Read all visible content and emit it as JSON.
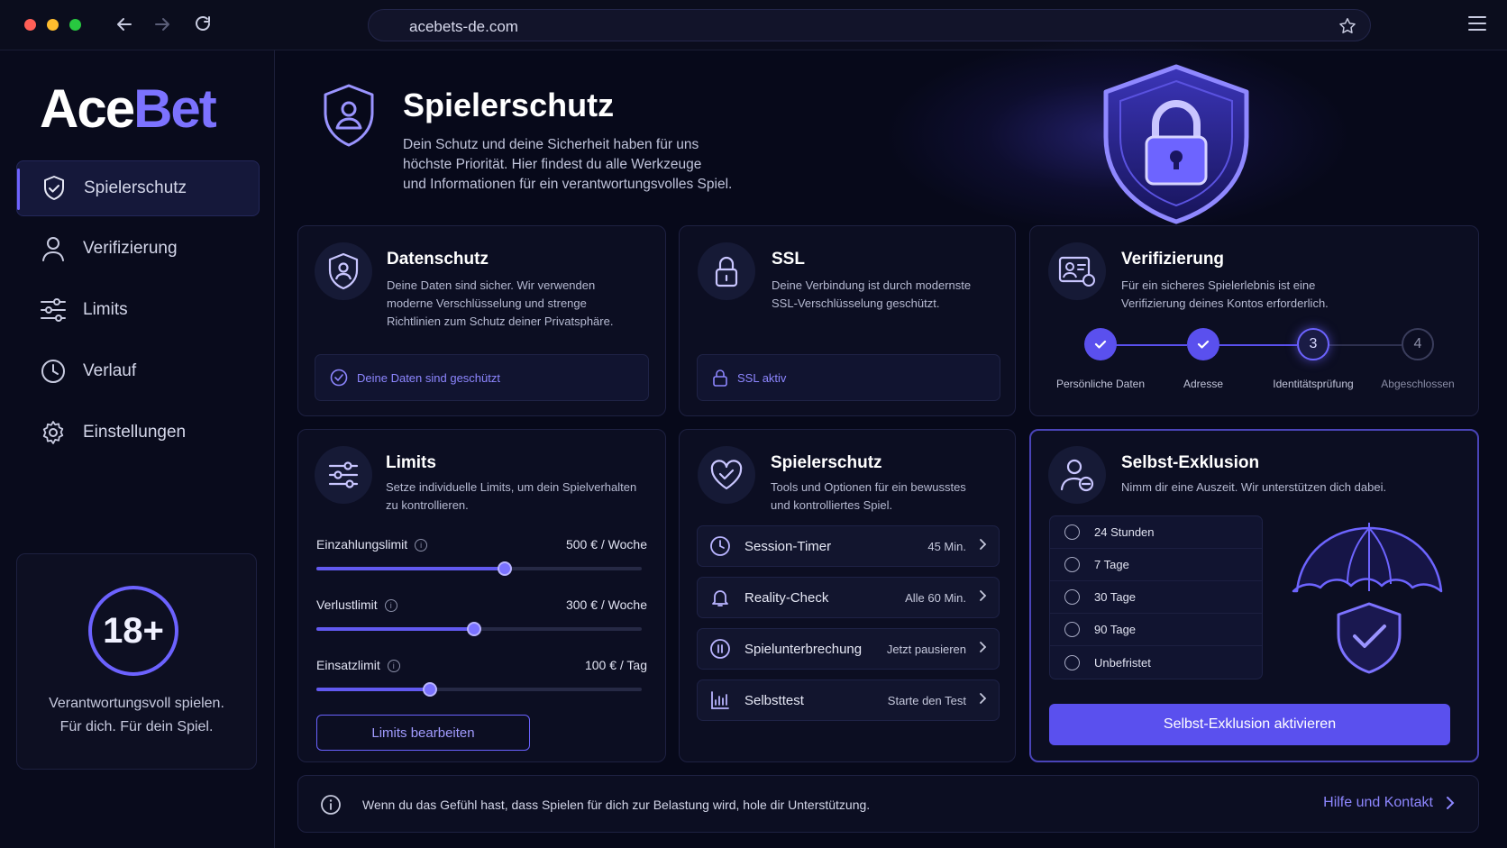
{
  "browser": {
    "url": "acebets-de.com",
    "icons": [
      "back-arrow-icon",
      "forward-arrow-icon",
      "reload-icon",
      "star-icon",
      "hamburger-menu-icon"
    ]
  },
  "brand": {
    "part1": "Ace",
    "part2": "Bet",
    "accent": "#7c72ff"
  },
  "sidebar": {
    "items": [
      {
        "label": "Spielerschutz",
        "icon": "shield-check-icon",
        "active": true
      },
      {
        "label": "Verifizierung",
        "icon": "user-icon"
      },
      {
        "label": "Limits",
        "icon": "sliders-icon"
      },
      {
        "label": "Verlauf",
        "icon": "clock-icon"
      },
      {
        "label": "Einstellungen",
        "icon": "gear-icon"
      }
    ],
    "age_badge": "18+",
    "age_text_line1": "Verantwortungsvoll spielen.",
    "age_text_line2": "Für dich. Für dein Spiel."
  },
  "header": {
    "title": "Spielerschutz",
    "subtitle_line1": "Dein Schutz und deine Sicherheit haben für uns",
    "subtitle_line2": "höchste Priorität. Hier findest du alle Werkzeuge",
    "subtitle_line3": "und Informationen für ein verantwortungsvolles Spiel."
  },
  "cards": {
    "datenschutz": {
      "title": "Datenschutz",
      "desc_line1": "Deine Daten sind sicher. Wir verwenden",
      "desc_line2": "moderne Verschlüsselung und strenge",
      "desc_line3": "Richtlinien zum Schutz deiner Privatsphäre.",
      "status": "Deine Daten sind geschützt"
    },
    "ssl": {
      "title": "SSL",
      "desc_line1": "Deine Verbindung ist durch modernste",
      "desc_line2": "SSL-Verschlüsselung geschützt.",
      "status": "SSL aktiv"
    },
    "verifizierung": {
      "title": "Verifizierung",
      "desc_line1": "Für ein sicheres Spielerlebnis ist eine",
      "desc_line2": "Verifizierung deines Kontos erforderlich.",
      "steps": [
        {
          "label": "Persönliche Daten",
          "state": "done",
          "num": ""
        },
        {
          "label": "Adresse",
          "state": "done",
          "num": ""
        },
        {
          "label": "Identitätsprüfung",
          "state": "current",
          "num": "3"
        },
        {
          "label": "Abgeschlossen",
          "state": "todo",
          "num": "4"
        }
      ]
    },
    "limits": {
      "title": "Limits",
      "desc_line1": "Setze individuelle Limits, um dein Spielverhalten",
      "desc_line2": "zu kontrollieren.",
      "items": [
        {
          "label": "Einzahlungslimit",
          "value": "500 € / Woche",
          "fill_fraction": 0.58
        },
        {
          "label": "Verlustlimit",
          "value": "300 € / Woche",
          "fill_fraction": 0.485
        },
        {
          "label": "Einsatzlimit",
          "value": "100 € / Tag",
          "fill_fraction": 0.35
        }
      ],
      "button": "Limits bearbeiten"
    },
    "spielerschutz": {
      "title": "Spielerschutz",
      "desc_line1": "Tools und Optionen für ein bewusstes",
      "desc_line2": "und kontrolliertes Spiel.",
      "rows": [
        {
          "label": "Session-Timer",
          "value": "45 Min.",
          "icon": "clock-icon"
        },
        {
          "label": "Reality-Check",
          "value": "Alle 60 Min.",
          "icon": "bell-icon"
        },
        {
          "label": "Spielunterbrechung",
          "value": "Jetzt pausieren",
          "icon": "pause-icon"
        },
        {
          "label": "Selbsttest",
          "value": "Starte den Test",
          "icon": "chart-icon"
        }
      ]
    },
    "exclusion": {
      "title": "Selbst-Exklusion",
      "desc": "Nimm dir eine Auszeit. Wir unterstützen dich dabei.",
      "options": [
        "24 Stunden",
        "7 Tage",
        "30 Tage",
        "90 Tage",
        "Unbefristet"
      ],
      "button": "Selbst-Exklusion aktivieren"
    }
  },
  "footer": {
    "text": "Wenn du das Gefühl hast, dass Spielen für dich zur Belastung wird, hole dir Unterstützung.",
    "link": "Hilfe und Kontakt"
  }
}
